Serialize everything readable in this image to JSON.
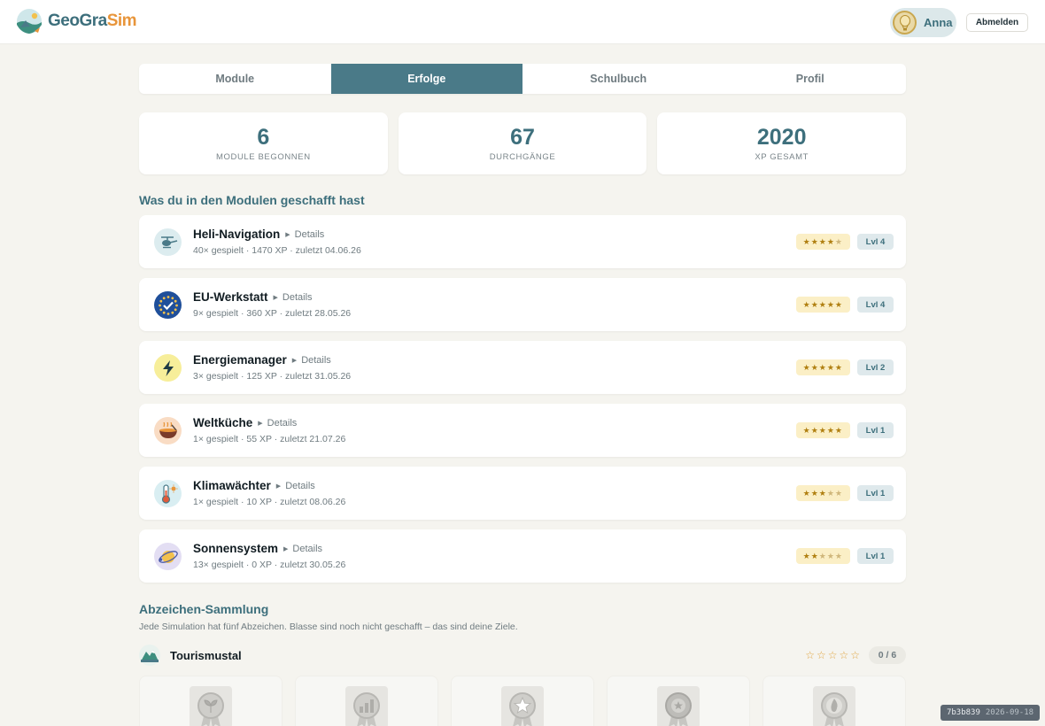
{
  "app": {
    "logo_part1": "GeoGra",
    "logo_part2": "Sim",
    "brand_color": "#3d6f7c",
    "accent_color": "#e8953a"
  },
  "user": {
    "name": "Anna",
    "logout_label": "Abmelden"
  },
  "tabs": [
    {
      "label": "Module",
      "active": false
    },
    {
      "label": "Erfolge",
      "active": true
    },
    {
      "label": "Schulbuch",
      "active": false
    },
    {
      "label": "Profil",
      "active": false
    }
  ],
  "stats": [
    {
      "value": "6",
      "label": "MODULE BEGONNEN"
    },
    {
      "value": "67",
      "label": "DURCHGÄNGE"
    },
    {
      "value": "2020",
      "label": "XP GESAMT"
    }
  ],
  "modules_section": {
    "title": "Was du in den Modulen geschafft hast"
  },
  "modules": [
    {
      "icon": "helicopter-icon",
      "title": "Heli-Navigation",
      "details": "Details",
      "meta": "40× gespielt · 1470 XP · zuletzt 04.06.26",
      "stars": 4,
      "level": "Lvl 4"
    },
    {
      "icon": "eu-stars-icon",
      "title": "EU-Werkstatt",
      "details": "Details",
      "meta": "9× gespielt · 360 XP · zuletzt 28.05.26",
      "stars": 5,
      "level": "Lvl 4"
    },
    {
      "icon": "lightning-icon",
      "title": "Energiemanager",
      "details": "Details",
      "meta": "3× gespielt · 125 XP · zuletzt 31.05.26",
      "stars": 5,
      "level": "Lvl 2"
    },
    {
      "icon": "soup-bowl-icon",
      "title": "Weltküche",
      "details": "Details",
      "meta": "1× gespielt · 55 XP · zuletzt 21.07.26",
      "stars": 5,
      "level": "Lvl 1"
    },
    {
      "icon": "thermometer-sun-icon",
      "title": "Klimawächter",
      "details": "Details",
      "meta": "1× gespielt · 10 XP · zuletzt 08.06.26",
      "stars": 3,
      "level": "Lvl 1"
    },
    {
      "icon": "planet-orbit-icon",
      "title": "Sonnensystem",
      "details": "Details",
      "meta": "13× gespielt · 0 XP · zuletzt 30.05.26",
      "stars": 2,
      "level": "Lvl 1"
    }
  ],
  "badges_section": {
    "title": "Abzeichen-Sammlung",
    "subtitle": "Jede Simulation hat fünf Abzeichen. Blasse sind noch nicht geschafft – das sind deine Ziele."
  },
  "badge_group": {
    "icon": "mountain-valley-icon",
    "title": "Tourismustal",
    "stars": 0,
    "count": "0 / 6",
    "badges": [
      {
        "icon": "sprout-medal-icon"
      },
      {
        "icon": "chart-medal-icon"
      },
      {
        "icon": "star-medal-icon"
      },
      {
        "icon": "laurel-medal-icon"
      },
      {
        "icon": "flame-medal-icon"
      }
    ]
  },
  "build": {
    "hash": "7b3b839",
    "date": "2026-09-18"
  }
}
